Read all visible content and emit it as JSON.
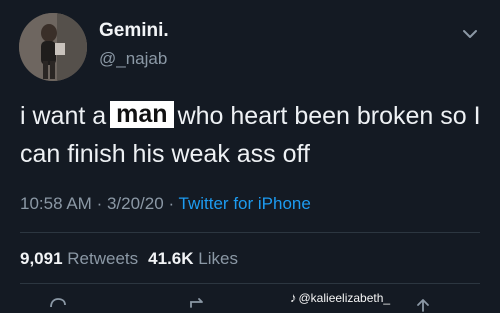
{
  "author": {
    "display_name": "Gemini.",
    "handle": "@_najab"
  },
  "tweet": {
    "text_before": "i want a",
    "highlighted_word": "man",
    "text_after": "who heart been broken so I can finish his weak ass off"
  },
  "meta": {
    "time": "10:58 AM",
    "sep1": "·",
    "date": "3/20/20",
    "sep2": "·",
    "source": "Twitter for iPhone"
  },
  "stats": {
    "retweets_count": "9,091",
    "retweets_label": "Retweets",
    "likes_count": "41.6K",
    "likes_label": "Likes"
  },
  "watermark": {
    "text": "@kalieelizabeth_"
  },
  "colors": {
    "background": "#141a23",
    "link": "#1d9bf0",
    "secondary_text": "#8b98a5"
  }
}
